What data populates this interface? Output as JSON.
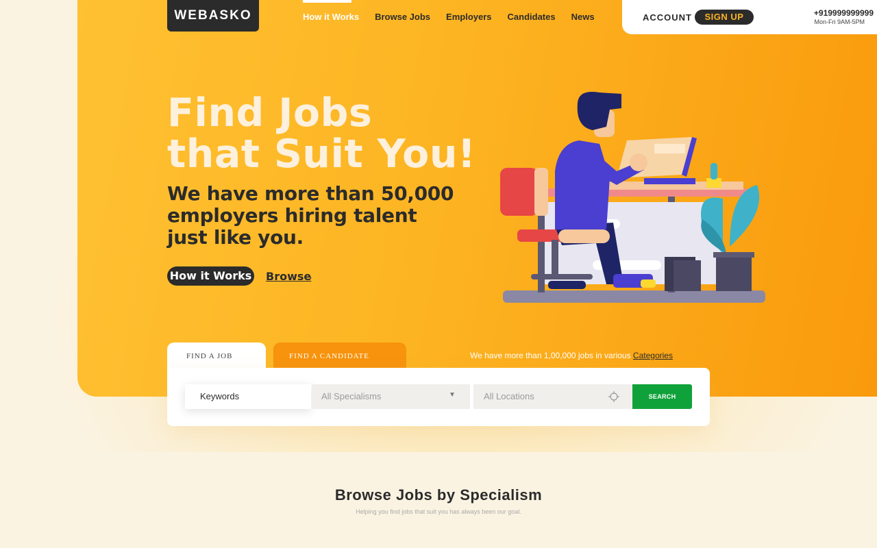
{
  "brand": {
    "logo_text": "WEBASKO"
  },
  "nav": {
    "items": [
      {
        "label": "How it Works",
        "active": true
      },
      {
        "label": "Browse Jobs"
      },
      {
        "label": "Employers"
      },
      {
        "label": "Candidates"
      },
      {
        "label": "News"
      }
    ]
  },
  "account": {
    "account_label": "ACCOUNT",
    "signup_label": "SIGN UP",
    "phone": "+919999999999",
    "hours": "Mon-Fri 9AM-5PM"
  },
  "hero": {
    "headline_line1": "Find Jobs",
    "headline_line2": "that Suit You!",
    "subhead": "We have more than 50,000 employers hiring talent just like you.",
    "how_button": "How it Works",
    "browse_link": "Browse",
    "browse_chevron": "›"
  },
  "search": {
    "tab_find_job": "FIND A JOB",
    "tab_find_candidate": "FIND A CANDIDATE",
    "jobs_count_text": "We have more than 1,00,000 jobs in various ",
    "categories_link": "Categories",
    "keywords_value": "Keywords",
    "specialism_placeholder": "All Specialisms",
    "specialism_arrow": "▼",
    "location_placeholder": "All Locations",
    "search_button": "SEARCH"
  },
  "section": {
    "title": "Browse Jobs by Specialism",
    "subtitle": "Helping you find jobs that suit you has always been our goal."
  },
  "colors": {
    "hero_start": "#fec132",
    "hero_end": "#f99a0c",
    "dark": "#2b2b2b",
    "accent_orange": "#f7930d",
    "search_green": "#10a23a"
  }
}
